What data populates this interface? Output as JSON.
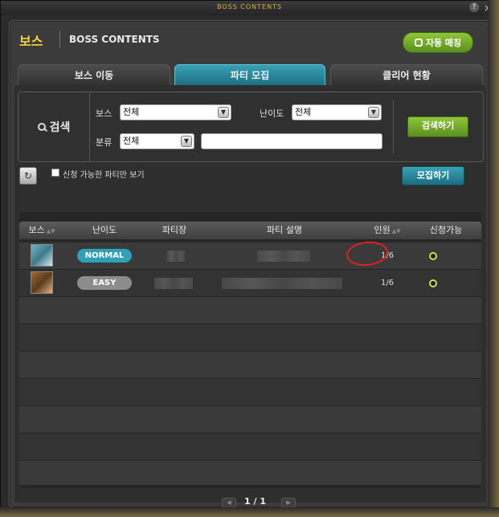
{
  "window": {
    "title": "BOSS CONTENTS",
    "help": "?",
    "close": "×"
  },
  "header": {
    "brand": "보스",
    "subtitle": "BOSS CONTENTS",
    "auto_match": "자동 매칭"
  },
  "tabs": [
    {
      "label": "보스 이동",
      "active": false
    },
    {
      "label": "파티 모집",
      "active": true
    },
    {
      "label": "클리어 현황",
      "active": false
    }
  ],
  "search": {
    "label": "검색",
    "boss_label": "보스",
    "boss_value": "전체",
    "difficulty_label": "난이도",
    "difficulty_value": "전체",
    "category_label": "분류",
    "category_value": "전체",
    "keyword_value": "",
    "button": "검색하기"
  },
  "toolbar": {
    "available_only_label": "신청 가능한 파티만 보기",
    "available_only_checked": false,
    "recruit_button": "모집하기"
  },
  "table": {
    "headers": [
      "보스",
      "난이도",
      "파티장",
      "파티 설명",
      "인원",
      "신청가능"
    ],
    "rows": [
      {
        "difficulty": "NORMAL",
        "difficulty_color": "#2fa0b5",
        "members": "1/6",
        "available": true
      },
      {
        "difficulty": "EASY",
        "difficulty_color": "#8c8c8c",
        "members": "1/6",
        "available": true
      }
    ]
  },
  "pager": {
    "text": "1 / 1"
  },
  "colors": {
    "accent_green": "#7ab534",
    "accent_teal": "#2b8ea3",
    "brand_yellow": "#f2d83a",
    "highlight_red": "#e02020"
  }
}
